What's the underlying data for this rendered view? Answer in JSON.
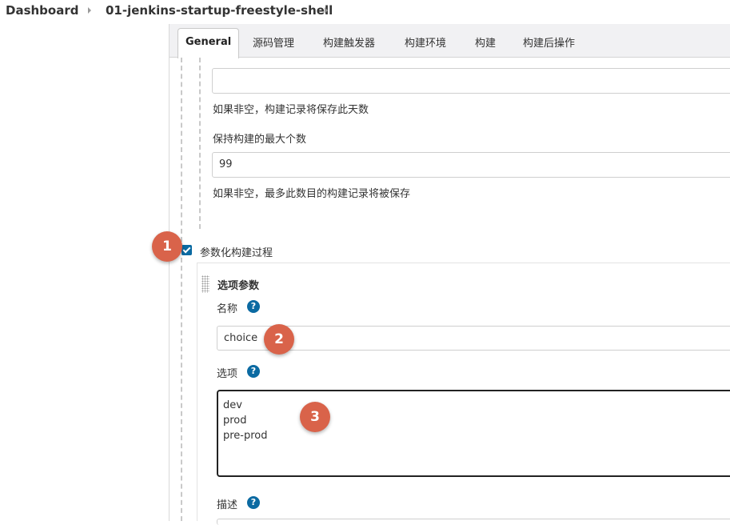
{
  "breadcrumb": {
    "items": [
      "Dashboard",
      "01-jenkins-startup-freestyle-shell"
    ]
  },
  "tabs": [
    {
      "label": "General",
      "active": true
    },
    {
      "label": "源码管理",
      "active": false
    },
    {
      "label": "构建触发器",
      "active": false
    },
    {
      "label": "构建环境",
      "active": false
    },
    {
      "label": "构建",
      "active": false
    },
    {
      "label": "构建后操作",
      "active": false
    }
  ],
  "discard": {
    "days_value": "",
    "days_help": "如果非空，构建记录将保存此天数",
    "max_label": "保持构建的最大个数",
    "max_value": "99",
    "max_help": "如果非空，最多此数目的构建记录将被保存"
  },
  "parameterized": {
    "checked": true,
    "label": "参数化构建过程",
    "param_title": "选项参数",
    "name_label": "名称",
    "name_value": "choice",
    "choices_label": "选项",
    "choices_value": "dev\nprod\npre-prod",
    "desc_label": "描述",
    "help_glyph": "?"
  },
  "annotations": [
    "1",
    "2",
    "3"
  ],
  "colors": {
    "accent": "#0b6aa2",
    "badge": "#d9634a",
    "tabbar_bg": "#f1f1f3"
  }
}
